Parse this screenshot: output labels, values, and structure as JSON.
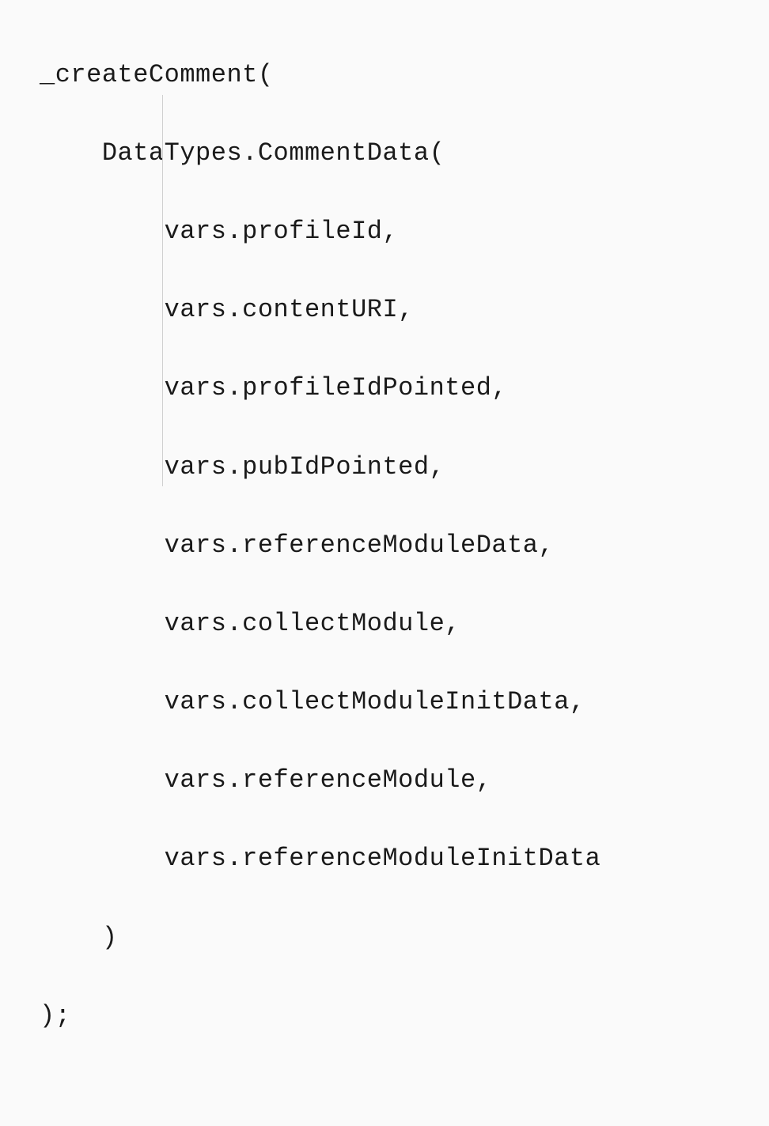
{
  "code": {
    "line1": "_createComment(",
    "line2": "    DataTypes.CommentData(",
    "line3": "        vars.profileId,",
    "line4": "        vars.contentURI,",
    "line5": "        vars.profileIdPointed,",
    "line6": "        vars.pubIdPointed,",
    "line7": "        vars.referenceModuleData,",
    "line8": "        vars.collectModule,",
    "line9": "        vars.collectModuleInitData,",
    "line10": "        vars.referenceModule,",
    "line11": "        vars.referenceModuleInitData",
    "line12": "    )",
    "line13": ");"
  }
}
